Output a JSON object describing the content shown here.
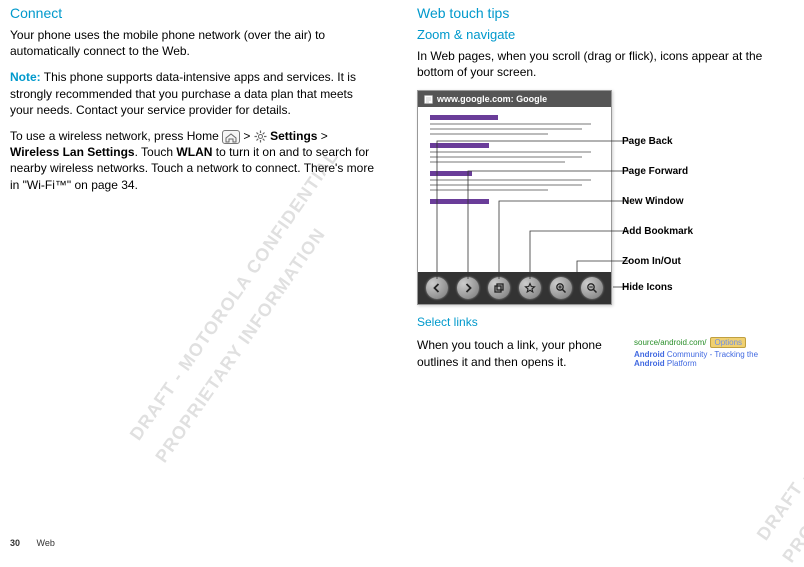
{
  "left": {
    "heading": "Connect",
    "p1": "Your phone uses the mobile phone network (over the air) to automatically connect to the Web.",
    "note_label": "Note:",
    "p2": " This phone supports data-intensive apps and services. It is strongly recommended that you purchase a data plan that meets your needs. Contact your service provider for details.",
    "p3a": "To use a wireless network, press Home ",
    "p3b": " > ",
    "settings": " Settings",
    "gt": " > ",
    "wlan_settings": "Wireless Lan Settings",
    "p3c": ". Touch ",
    "wlan": "WLAN",
    "p3d": " to turn it on and to search for nearby wireless networks. Touch a network to connect. There's more in \"Wi-Fi™\" on page 34."
  },
  "right": {
    "heading": "Web touch tips",
    "sub1": "Zoom & navigate",
    "p1": "In Web pages, when you scroll (drag or flick), icons appear at the bottom of your screen.",
    "titlebar": "www.google.com: Google",
    "legend": {
      "back": "Page Back",
      "forward": "Page Forward",
      "newwin": "New Window",
      "bookmark": "Add Bookmark",
      "zoom": "Zoom In/Out",
      "hide": "Hide Icons"
    },
    "sub2": "Select links",
    "p2": "When you touch a link, your phone outlines it and then opens it.",
    "preview": {
      "url": "source/android.com/",
      "options": "Options",
      "title_a": "Android",
      "title_b": " Community - Tracking the ",
      "title_c": "Android",
      "title_d": " Platform"
    }
  },
  "watermark": {
    "draft": "DRAFT - MOTOROLA CONFIDENTIAL",
    "prop": "PROPRIETARY INFORMATION"
  },
  "footer": {
    "page": "30",
    "section": "Web"
  }
}
